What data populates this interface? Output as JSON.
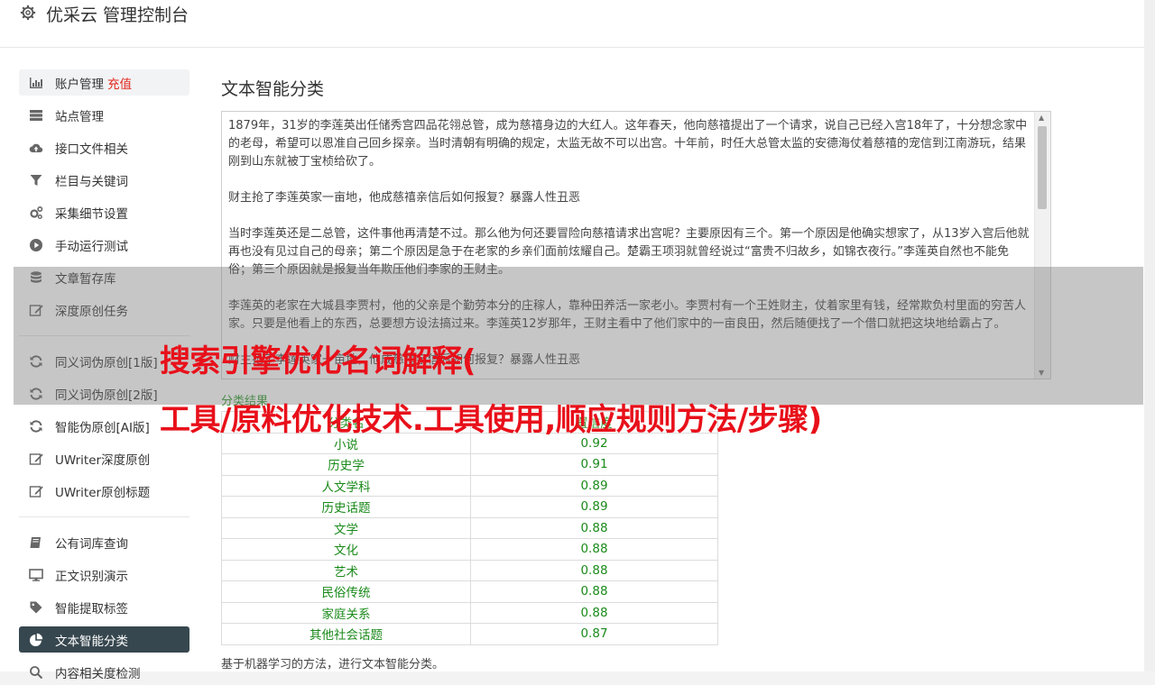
{
  "header": {
    "title": "优采云 管理控制台",
    "icon": "gear-icon"
  },
  "sidebar": {
    "items": [
      {
        "label": "账户管理",
        "badge": "充值",
        "icon": "bar-chart-icon"
      },
      {
        "label": "站点管理",
        "icon": "server-icon"
      },
      {
        "label": "接口文件相关",
        "icon": "cloud-upload-icon"
      },
      {
        "label": "栏目与关键词",
        "icon": "filter-icon"
      },
      {
        "label": "采集细节设置",
        "icon": "cogs-icon"
      },
      {
        "label": "手动运行测试",
        "icon": "play-circle-icon"
      },
      {
        "label": "文章暂存库",
        "icon": "database-icon"
      },
      {
        "label": "深度原创任务",
        "icon": "edit-icon"
      },
      {
        "label": "同义词伪原创[1版]",
        "icon": "refresh-icon"
      },
      {
        "label": "同义词伪原创[2版]",
        "icon": "refresh-icon"
      },
      {
        "label": "智能伪原创[AI版]",
        "icon": "refresh-icon"
      },
      {
        "label": "UWriter深度原创",
        "icon": "edit-icon"
      },
      {
        "label": "UWriter原创标题",
        "icon": "edit-icon"
      },
      {
        "label": "公有词库查询",
        "icon": "book-icon"
      },
      {
        "label": "正文识别演示",
        "icon": "desktop-icon"
      },
      {
        "label": "智能提取标签",
        "icon": "tag-icon"
      },
      {
        "label": "文本智能分类",
        "icon": "pie-chart-icon"
      },
      {
        "label": "内容相关度检测",
        "icon": "search-icon"
      }
    ]
  },
  "main": {
    "title": "文本智能分类",
    "text_content": "1879年，31岁的李莲英出任储秀宫四品花翎总管，成为慈禧身边的大红人。这年春天，他向慈禧提出了一个请求，说自己已经入宫18年了，十分想念家中的老母，希望可以恩准自己回乡探亲。当时清朝有明确的规定，太监无故不可以出宫。十年前，时任大总管太监的安德海仗着慈禧的宠信到江南游玩，结果刚到山东就被丁宝桢给砍了。\n\n财主抢了李莲英家一亩地，他成慈禧亲信后如何报复？暴露人性丑恶\n\n当时李莲英还是二总管，这件事他再清楚不过。那么他为何还要冒险向慈禧请求出宫呢？主要原因有三个。第一个原因是他确实想家了，从13岁入宫后他就再也没有见过自己的母亲；第二个原因是急于在老家的乡亲们面前炫耀自己。楚霸王项羽就曾经说过“富贵不归故乡，如锦衣夜行。”李莲英自然也不能免俗；第三个原因就是报复当年欺压他们李家的王财主。\n\n李莲英的老家在大城县李贾村，他的父亲是个勤劳本分的庄稼人，靠种田养活一家老小。李贾村有一个王姓财主，仗着家里有钱，经常欺负村里面的穷苦人家。只要是他看上的东西，总要想方设法搞过来。李莲英12岁那年，王财主看中了他们家中的一亩良田，然后随便找了一个借口就把这块地给霸占了。\n\n财主抢了李莲英家一亩地，他成慈禧亲信后如何报复？暴露人性丑恶",
    "result_label": "分类结果",
    "table": {
      "headers": [
        "分类名",
        "置信度"
      ],
      "rows": [
        [
          "小说",
          "0.92"
        ],
        [
          "历史学",
          "0.91"
        ],
        [
          "人文学科",
          "0.89"
        ],
        [
          "历史话题",
          "0.89"
        ],
        [
          "文学",
          "0.88"
        ],
        [
          "文化",
          "0.88"
        ],
        [
          "艺术",
          "0.88"
        ],
        [
          "民俗传统",
          "0.88"
        ],
        [
          "家庭关系",
          "0.88"
        ],
        [
          "其他社会话题",
          "0.87"
        ]
      ]
    },
    "footnote": "基于机器学习的方法，进行文本智能分类。"
  },
  "overlay": {
    "line1": "搜索引擎优化名词解释(",
    "line2": "工具/原料优化技术.工具使用,顺应规则方法/步骤)"
  },
  "colors": {
    "active_nav": "#37474f",
    "recharge": "#e1261c",
    "result_green": "#1a8a1a",
    "overlay_text": "#e8101a"
  }
}
